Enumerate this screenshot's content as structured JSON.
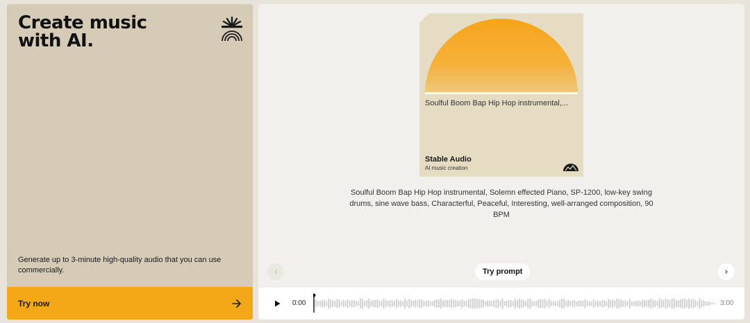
{
  "hero": {
    "headline": "Create music\nwith AI.",
    "logo_icon": "sun-rainbow-logo-icon",
    "description": "Generate up to 3-minute high-quality audio that you can use commercially.",
    "cta_label": "Try now",
    "cta_icon": "arrow-right-icon"
  },
  "track": {
    "cover_caption": "Soulful Boom Bap Hip Hop instrumental,...",
    "brand": "Stable Audio",
    "brand_tagline": "AI music creation",
    "prompt": "Soulful Boom Bap Hip Hop instrumental, Solemn effected Piano, SP-1200, low-key swing drums, sine wave bass, Characterful, Peaceful, Interesting, well-arranged composition, 90 BPM"
  },
  "controls": {
    "prev_icon": "chevron-left-icon",
    "next_icon": "chevron-right-icon",
    "try_prompt_label": "Try prompt"
  },
  "player": {
    "play_icon": "play-icon",
    "current_time": "0:00",
    "total_time": "3:00",
    "progress": 0
  },
  "colors": {
    "accent": "#f5a817",
    "left_card_bg": "#d5cbb6",
    "panel_bg": "#f2f0ec",
    "cover_bg": "#e5dcc3",
    "waveform": "#c9c9c9"
  }
}
